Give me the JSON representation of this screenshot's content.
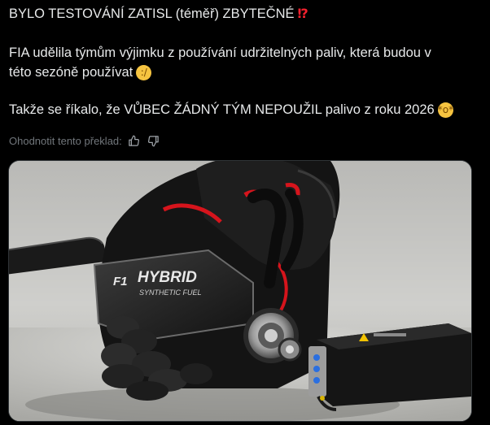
{
  "post": {
    "line1": "BYLO TESTOVÁNÍ ZATISL (téměř) ZBYTEČNÉ",
    "line1_emoji": "⁉",
    "line2": "FIA udělila týmům výjimku z používání udržitelných paliv, která budou v",
    "line3": "této sezóně používat",
    "line3_emoji": "🫤",
    "line4": "Takže se říkalo, že VŮBEC ŽÁDNÝ TÝM NEPOUŽIL palivo z roku 2026",
    "line4_emoji": "🤯"
  },
  "translation": {
    "rate_label": "Ohodnotit tento překlad:",
    "like_icon": "thumbs-up-icon",
    "dislike_icon": "thumbs-down-icon"
  },
  "media": {
    "engine_logo": "F1",
    "engine_text1": "HYBRID",
    "engine_text2": "SYNTHETIC FUEL",
    "colors": {
      "background_gray": "#c9c9c6",
      "engine_black": "#141414",
      "accent_red": "#d6141c",
      "connector_blue": "#2b6fe0",
      "warning_yellow": "#f2c200"
    }
  }
}
